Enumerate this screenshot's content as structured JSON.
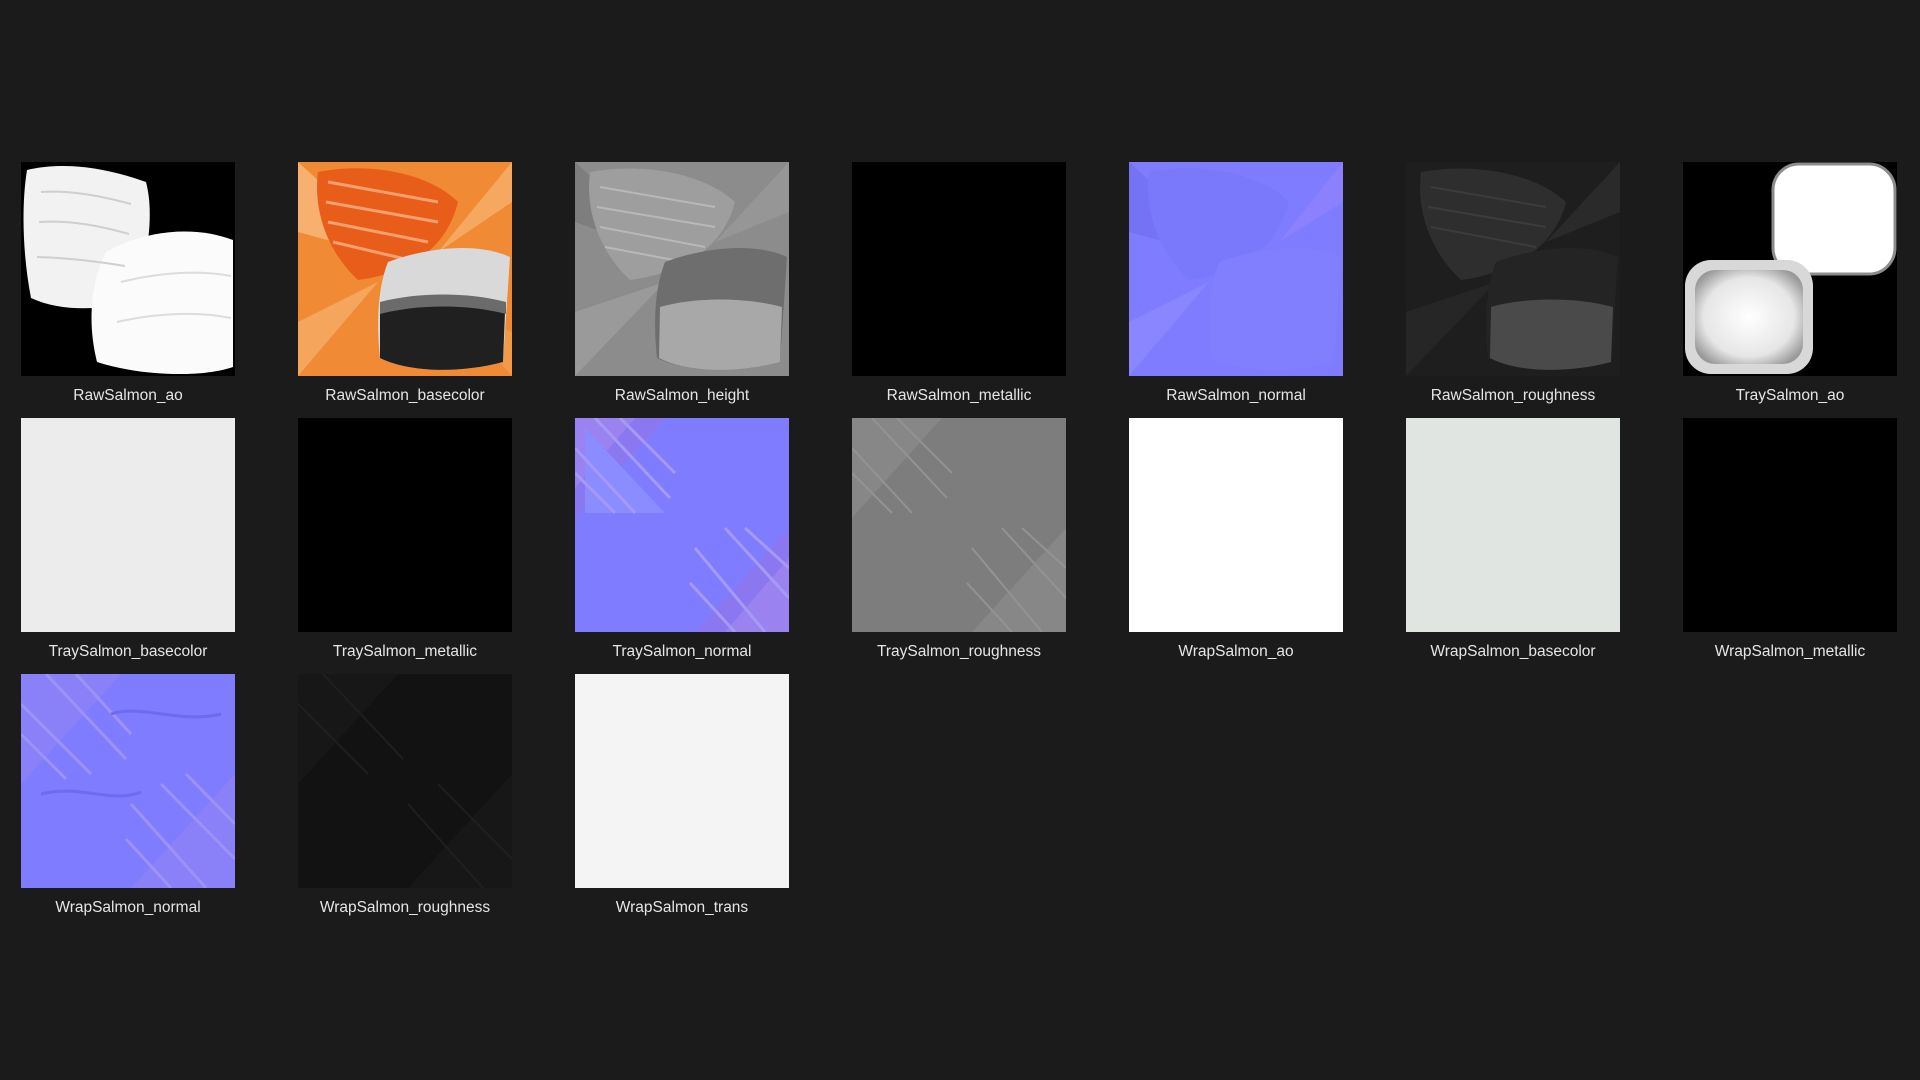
{
  "gallery": {
    "items": [
      {
        "name": "RawSalmon_ao",
        "icon": "ao-map-thumbnail"
      },
      {
        "name": "RawSalmon_basecolor",
        "icon": "basecolor-map-thumbnail"
      },
      {
        "name": "RawSalmon_height",
        "icon": "height-map-thumbnail"
      },
      {
        "name": "RawSalmon_metallic",
        "icon": "metallic-map-thumbnail"
      },
      {
        "name": "RawSalmon_normal",
        "icon": "normal-map-thumbnail"
      },
      {
        "name": "RawSalmon_roughness",
        "icon": "roughness-map-thumbnail"
      },
      {
        "name": "TraySalmon_ao",
        "icon": "ao-map-thumbnail"
      },
      {
        "name": "TraySalmon_basecolor",
        "icon": "basecolor-map-thumbnail"
      },
      {
        "name": "TraySalmon_metallic",
        "icon": "metallic-map-thumbnail"
      },
      {
        "name": "TraySalmon_normal",
        "icon": "normal-map-thumbnail"
      },
      {
        "name": "TraySalmon_roughness",
        "icon": "roughness-map-thumbnail"
      },
      {
        "name": "WrapSalmon_ao",
        "icon": "ao-map-thumbnail"
      },
      {
        "name": "WrapSalmon_basecolor",
        "icon": "basecolor-map-thumbnail"
      },
      {
        "name": "WrapSalmon_metallic",
        "icon": "metallic-map-thumbnail"
      },
      {
        "name": "WrapSalmon_normal",
        "icon": "normal-map-thumbnail"
      },
      {
        "name": "WrapSalmon_roughness",
        "icon": "roughness-map-thumbnail"
      },
      {
        "name": "WrapSalmon_trans",
        "icon": "transmission-map-thumbnail"
      }
    ]
  },
  "colors": {
    "background": "#1b1b1c",
    "caption": "#e6e6e6",
    "normal_map_base": "#7f7fff",
    "salmon_orange": "#f07d2a"
  }
}
